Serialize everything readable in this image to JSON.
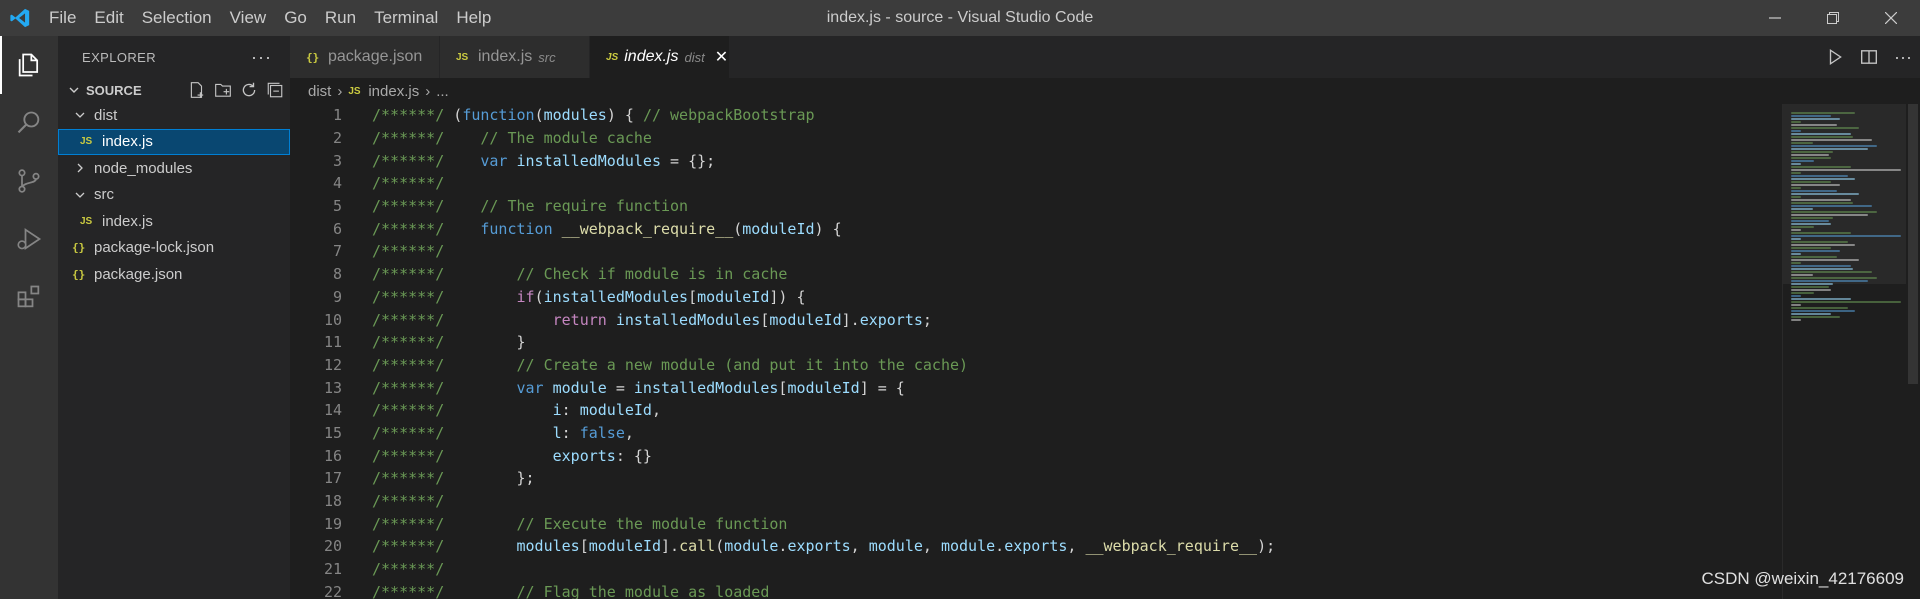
{
  "window": {
    "title": "index.js - source - Visual Studio Code"
  },
  "menu": [
    "File",
    "Edit",
    "Selection",
    "View",
    "Go",
    "Run",
    "Terminal",
    "Help"
  ],
  "sidebar": {
    "title": "EXPLORER",
    "section": "SOURCE",
    "tree": [
      {
        "label": "dist",
        "type": "folder-open",
        "indent": 1,
        "selected": false
      },
      {
        "label": "index.js",
        "type": "js",
        "indent": 2,
        "selected": true
      },
      {
        "label": "node_modules",
        "type": "folder-closed",
        "indent": 1,
        "selected": false
      },
      {
        "label": "src",
        "type": "folder-open",
        "indent": 1,
        "selected": false
      },
      {
        "label": "index.js",
        "type": "js",
        "indent": 2,
        "selected": false
      },
      {
        "label": "package-lock.json",
        "type": "json",
        "indent": 1,
        "selected": false
      },
      {
        "label": "package.json",
        "type": "json",
        "indent": 1,
        "selected": false
      }
    ]
  },
  "tabs": [
    {
      "label": "package.json",
      "icon": "json",
      "detail": "",
      "active": false
    },
    {
      "label": "index.js",
      "icon": "js",
      "detail": "src",
      "active": false
    },
    {
      "label": "index.js",
      "icon": "js",
      "detail": "dist",
      "active": true
    }
  ],
  "breadcrumb": [
    "dist",
    "index.js",
    "..."
  ],
  "editor": {
    "lines": [
      {
        "n": "1",
        "tokens": [
          [
            "cm",
            "/******/ "
          ],
          [
            "pl",
            "("
          ],
          [
            "kw",
            "function"
          ],
          [
            "pl",
            "("
          ],
          [
            "var",
            "modules"
          ],
          [
            "pl",
            ") { "
          ],
          [
            "cm",
            "// webpackBootstrap"
          ]
        ]
      },
      {
        "n": "2",
        "tokens": [
          [
            "cm",
            "/******/ "
          ],
          [
            "pl",
            "   "
          ],
          [
            "cm",
            "// The module cache"
          ]
        ]
      },
      {
        "n": "3",
        "tokens": [
          [
            "cm",
            "/******/ "
          ],
          [
            "pl",
            "   "
          ],
          [
            "kw",
            "var"
          ],
          [
            "pl",
            " "
          ],
          [
            "var",
            "installedModules"
          ],
          [
            "pl",
            " = {};"
          ]
        ]
      },
      {
        "n": "4",
        "tokens": [
          [
            "cm",
            "/******/"
          ]
        ]
      },
      {
        "n": "5",
        "tokens": [
          [
            "cm",
            "/******/ "
          ],
          [
            "pl",
            "   "
          ],
          [
            "cm",
            "// The require function"
          ]
        ]
      },
      {
        "n": "6",
        "tokens": [
          [
            "cm",
            "/******/ "
          ],
          [
            "pl",
            "   "
          ],
          [
            "kw",
            "function"
          ],
          [
            "pl",
            " "
          ],
          [
            "fn",
            "__webpack_require__"
          ],
          [
            "pl",
            "("
          ],
          [
            "var",
            "moduleId"
          ],
          [
            "pl",
            ") {"
          ]
        ]
      },
      {
        "n": "7",
        "tokens": [
          [
            "cm",
            "/******/"
          ]
        ]
      },
      {
        "n": "8",
        "tokens": [
          [
            "cm",
            "/******/ "
          ],
          [
            "pl",
            "       "
          ],
          [
            "cm",
            "// Check if module is in cache"
          ]
        ]
      },
      {
        "n": "9",
        "tokens": [
          [
            "cm",
            "/******/ "
          ],
          [
            "pl",
            "       "
          ],
          [
            "ctl",
            "if"
          ],
          [
            "pl",
            "("
          ],
          [
            "var",
            "installedModules"
          ],
          [
            "pl",
            "["
          ],
          [
            "var",
            "moduleId"
          ],
          [
            "pl",
            "]) {"
          ]
        ]
      },
      {
        "n": "10",
        "tokens": [
          [
            "cm",
            "/******/ "
          ],
          [
            "pl",
            "           "
          ],
          [
            "ctl",
            "return"
          ],
          [
            "pl",
            " "
          ],
          [
            "var",
            "installedModules"
          ],
          [
            "pl",
            "["
          ],
          [
            "var",
            "moduleId"
          ],
          [
            "pl",
            "]."
          ],
          [
            "var",
            "exports"
          ],
          [
            "pl",
            ";"
          ]
        ]
      },
      {
        "n": "11",
        "tokens": [
          [
            "cm",
            "/******/ "
          ],
          [
            "pl",
            "       }"
          ]
        ]
      },
      {
        "n": "12",
        "tokens": [
          [
            "cm",
            "/******/ "
          ],
          [
            "pl",
            "       "
          ],
          [
            "cm",
            "// Create a new module (and put it into the cache)"
          ]
        ]
      },
      {
        "n": "13",
        "tokens": [
          [
            "cm",
            "/******/ "
          ],
          [
            "pl",
            "       "
          ],
          [
            "kw",
            "var"
          ],
          [
            "pl",
            " "
          ],
          [
            "var",
            "module"
          ],
          [
            "pl",
            " = "
          ],
          [
            "var",
            "installedModules"
          ],
          [
            "pl",
            "["
          ],
          [
            "var",
            "moduleId"
          ],
          [
            "pl",
            "] = {"
          ]
        ]
      },
      {
        "n": "14",
        "tokens": [
          [
            "cm",
            "/******/ "
          ],
          [
            "pl",
            "           "
          ],
          [
            "var",
            "i"
          ],
          [
            "pl",
            ": "
          ],
          [
            "var",
            "moduleId"
          ],
          [
            "pl",
            ","
          ]
        ]
      },
      {
        "n": "15",
        "tokens": [
          [
            "cm",
            "/******/ "
          ],
          [
            "pl",
            "           "
          ],
          [
            "var",
            "l"
          ],
          [
            "pl",
            ": "
          ],
          [
            "kw",
            "false"
          ],
          [
            "pl",
            ","
          ]
        ]
      },
      {
        "n": "16",
        "tokens": [
          [
            "cm",
            "/******/ "
          ],
          [
            "pl",
            "           "
          ],
          [
            "var",
            "exports"
          ],
          [
            "pl",
            ": {}"
          ]
        ]
      },
      {
        "n": "17",
        "tokens": [
          [
            "cm",
            "/******/ "
          ],
          [
            "pl",
            "       };"
          ]
        ]
      },
      {
        "n": "18",
        "tokens": [
          [
            "cm",
            "/******/"
          ]
        ]
      },
      {
        "n": "19",
        "tokens": [
          [
            "cm",
            "/******/ "
          ],
          [
            "pl",
            "       "
          ],
          [
            "cm",
            "// Execute the module function"
          ]
        ]
      },
      {
        "n": "20",
        "tokens": [
          [
            "cm",
            "/******/ "
          ],
          [
            "pl",
            "       "
          ],
          [
            "var",
            "modules"
          ],
          [
            "pl",
            "["
          ],
          [
            "var",
            "moduleId"
          ],
          [
            "pl",
            "]."
          ],
          [
            "fn",
            "call"
          ],
          [
            "pl",
            "("
          ],
          [
            "var",
            "module"
          ],
          [
            "pl",
            "."
          ],
          [
            "var",
            "exports"
          ],
          [
            "pl",
            ", "
          ],
          [
            "var",
            "module"
          ],
          [
            "pl",
            ", "
          ],
          [
            "var",
            "module"
          ],
          [
            "pl",
            "."
          ],
          [
            "var",
            "exports"
          ],
          [
            "pl",
            ", "
          ],
          [
            "fn",
            "__webpack_require__"
          ],
          [
            "pl",
            ");"
          ]
        ]
      },
      {
        "n": "21",
        "tokens": [
          [
            "cm",
            "/******/"
          ]
        ]
      },
      {
        "n": "22",
        "tokens": [
          [
            "cm",
            "/******/ "
          ],
          [
            "pl",
            "       "
          ],
          [
            "cm",
            "// Flag the module as loaded"
          ]
        ]
      }
    ]
  },
  "watermark": "CSDN @weixin_42176609",
  "colors": {
    "accent": "#007acc",
    "selection": "#094771",
    "comment": "#6a9955",
    "keyword": "#569cd6",
    "variable": "#9cdcfe",
    "function": "#dcdcaa",
    "control": "#c586c0"
  }
}
